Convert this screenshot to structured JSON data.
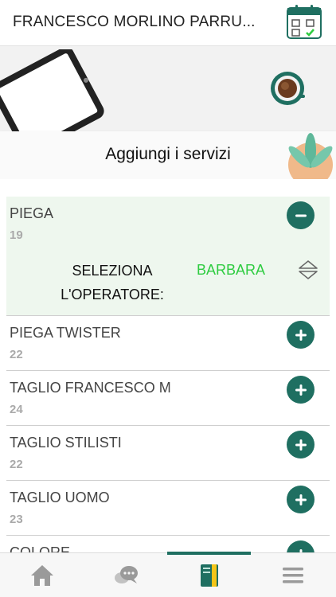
{
  "header": {
    "title": "FRANCESCO MORLINO PARRU...",
    "calendar_icon": "calendar-check-icon"
  },
  "banner": {
    "label": "Aggiungi i servizi",
    "coffee_icon": "coffee-cup-icon"
  },
  "services": [
    {
      "name": "PIEGA",
      "price": "19",
      "selected": true
    },
    {
      "name": "PIEGA TWISTER",
      "price": "22",
      "selected": false
    },
    {
      "name": "TAGLIO FRANCESCO M",
      "price": "24",
      "selected": false
    },
    {
      "name": "TAGLIO STILISTI",
      "price": "22",
      "selected": false
    },
    {
      "name": "TAGLIO UOMO",
      "price": "23",
      "selected": false
    },
    {
      "name": "COLORE",
      "price": "",
      "selected": false
    }
  ],
  "operator": {
    "label": "SELEZIONA L'OPERATORE:",
    "value": "BARBARA"
  },
  "tabbar": {
    "tabs": [
      "home-icon",
      "chat-icon",
      "notebook-icon",
      "menu-icon"
    ],
    "active": "notebook-icon"
  },
  "colors": {
    "accent": "#1f6f61",
    "operator_text": "#2ecc40",
    "selected_bg": "#eef7ee"
  }
}
